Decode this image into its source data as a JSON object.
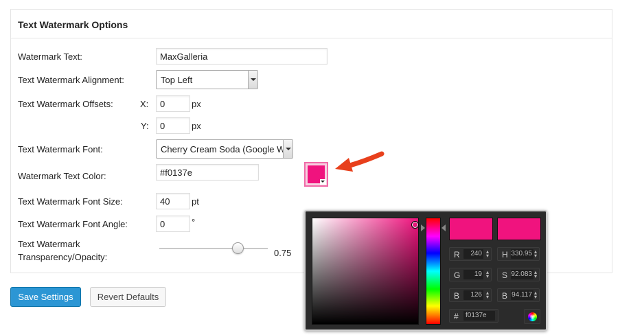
{
  "panel": {
    "title": "Text Watermark Options",
    "labels": {
      "watermark_text": "Watermark Text:",
      "alignment": "Text Watermark Alignment:",
      "offsets": "Text Watermark Offsets:",
      "offset_x": "X:",
      "offset_y": "Y:",
      "font": "Text Watermark Font:",
      "color": "Watermark Text Color:",
      "font_size": "Text Watermark Font Size:",
      "font_angle": "Text Watermark Font Angle:",
      "transparency_line1": "Text Watermark",
      "transparency_line2": "Transparency/Opacity:"
    },
    "values": {
      "watermark_text": "MaxGalleria",
      "alignment": "Top Left",
      "offset_x": "0",
      "offset_y": "0",
      "font": "Cherry Cream Soda (Google W",
      "color": "#f0137e",
      "font_size": "40",
      "font_angle": "0",
      "transparency": "0.75",
      "transparency_level": 0.75
    },
    "units": {
      "px_x": "px",
      "px_y": "px",
      "pt": "pt",
      "deg": "°"
    }
  },
  "buttons": {
    "save": "Save Settings",
    "revert": "Revert Defaults"
  },
  "color_picker": {
    "selected_color": "#f0137e",
    "previous_color": "#f0137e",
    "fields": {
      "r_label": "R",
      "r_value": "240",
      "g_label": "G",
      "g_value": "19",
      "b_label": "B",
      "b_value": "126",
      "h_label": "H",
      "h_value": "330.95",
      "s_label": "S",
      "s_value": "92.083",
      "bri_label": "B",
      "bri_value": "94.117",
      "hex_label": "#",
      "hex_value": "f0137e"
    }
  },
  "colors": {
    "accent": "#2c96d4",
    "watermark_color": "#f0137e",
    "arrow": "#e8401c"
  }
}
